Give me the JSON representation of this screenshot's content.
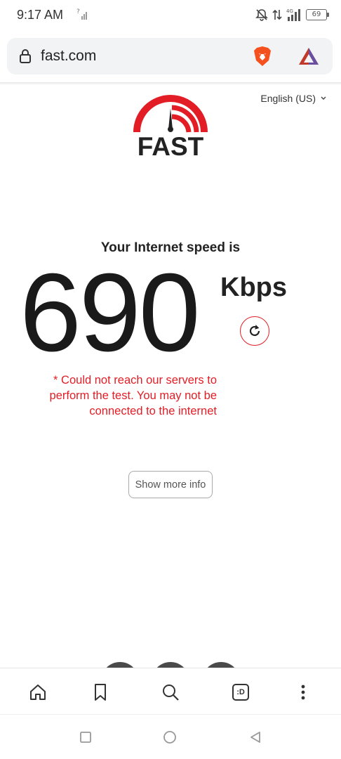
{
  "status_bar": {
    "time": "9:17 AM",
    "battery": "69",
    "network": "4G"
  },
  "address_bar": {
    "url": "fast.com"
  },
  "page": {
    "language": "English (US)",
    "logo_text": "FAST",
    "heading": "Your Internet speed is",
    "speed_value": "690",
    "speed_units": "Kbps",
    "error_message": "* Could not reach our servers to perform the test. You may not be connected to the internet",
    "more_info_label": "Show more info"
  },
  "toolbar": {
    "tabs_label": ":D"
  },
  "colors": {
    "brand_red": "#e31d25",
    "text_dark": "#222222"
  }
}
